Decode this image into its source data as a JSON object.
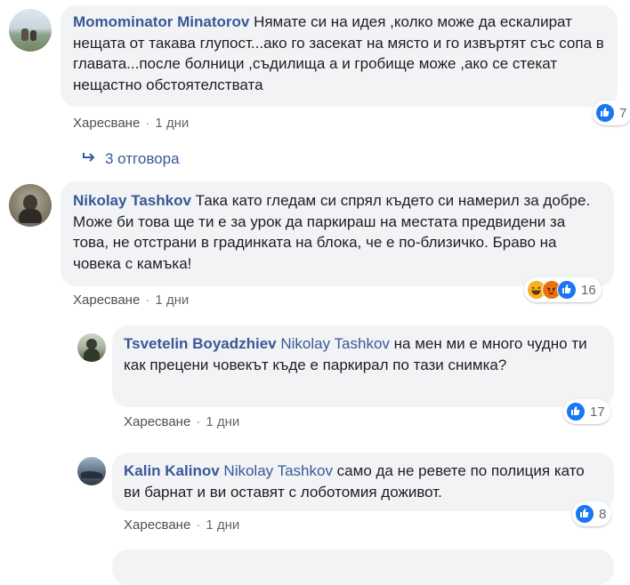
{
  "actions": {
    "like": "Харесване",
    "separator": "·"
  },
  "comments": [
    {
      "author": "Momominator Minatorov",
      "text": " Нямате си на идея ,колко може да ескалират нещата от такава глупост...ако го засекат на място и го извъртят със сопа в главата...после болници ,съдилища а и гробище може ,ако се стекат нещастно обстоятелствата",
      "age": "1 дни",
      "reactions": [
        "like-icon"
      ],
      "reaction_count": "7"
    },
    {
      "author": "Nikolay Tashkov",
      "text": " Така като гледам си спрял където си намерил за добре. Може би това ще ти е за урок да паркираш на местата предвидени за това, не отстрани в градинката на блока, че е по-близичко. Браво на човека с камъка!",
      "age": "1 дни",
      "reactions": [
        "haha-icon",
        "angry-icon",
        "like-icon"
      ],
      "reaction_count": "16"
    },
    {
      "author": "Tsvetelin Boyadzhiev",
      "mention": "Nikolay Tashkov",
      "text": " на мен ми е много чудно ти как прецени човекът къде е паркирал по тази снимка?",
      "age": "1 дни",
      "reactions": [
        "like-icon"
      ],
      "reaction_count": "17"
    },
    {
      "author": "Kalin Kalinov",
      "mention": "Nikolay Tashkov",
      "text": " само да не ревете по полиция като ви барнат и ви оставят с лоботомия доживот.",
      "age": "1 дни",
      "reactions": [
        "like-icon"
      ],
      "reaction_count": "8"
    }
  ],
  "replies_link": {
    "icon": "reply-arrow-icon",
    "label": "3 отговора"
  },
  "colors": {
    "link": "#385898",
    "bubble": "#f2f3f5",
    "like_blue": "#1877f2",
    "meta": "#90949c"
  }
}
